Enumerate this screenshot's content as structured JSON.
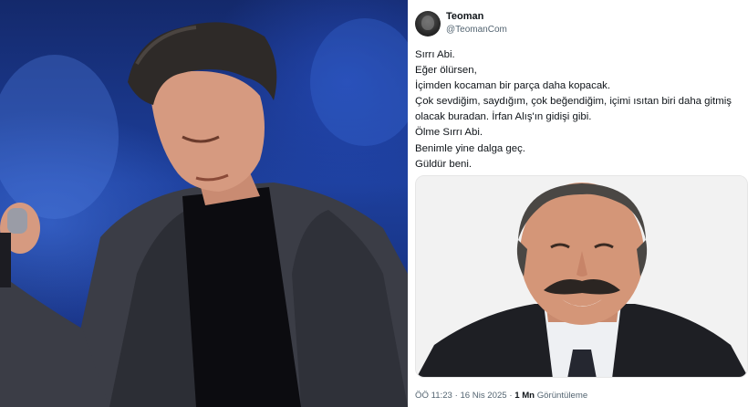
{
  "tweet": {
    "display_name": "Teoman",
    "handle": "@TeomanCom",
    "lines": [
      "Sırrı Abi.",
      "Eğer ölürsen,",
      "İçimden kocaman bir parça daha kopacak.",
      "Çok sevdiğim, saydığım, çok beğendiğim, içimi ısıtan biri daha gitmiş",
      "olacak buradan. İrfan Alış'ın gidişi gibi.",
      "Ölme Sırrı Abi.",
      "Benimle yine dalga geç.",
      "Güldür beni."
    ],
    "time": "ÖÖ 11:23",
    "separator": "·",
    "date": "16 Nis 2025",
    "views_count": "1 Mn",
    "views_label": "Görüntüleme"
  },
  "colors": {
    "text_primary": "#0f1419",
    "text_secondary": "#536471",
    "stage_blue": "#1d3f9c"
  },
  "icons": {
    "avatar": "profile-photo"
  }
}
